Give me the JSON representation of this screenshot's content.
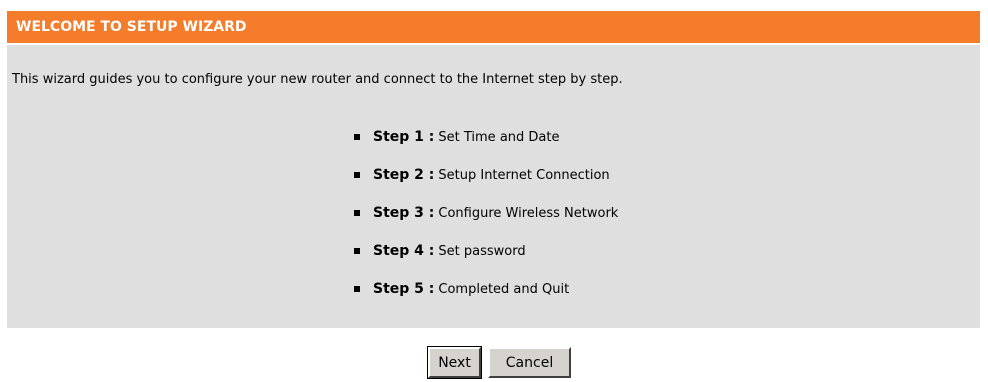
{
  "wizard": {
    "title": "WELCOME TO SETUP WIZARD",
    "intro": "This wizard guides you to configure your new router and connect to the Internet step by step.",
    "steps": [
      {
        "label": "Step 1 :",
        "text": "Set Time and Date"
      },
      {
        "label": "Step 2 :",
        "text": "Setup Internet Connection"
      },
      {
        "label": "Step 3 :",
        "text": "Configure Wireless Network"
      },
      {
        "label": "Step 4 :",
        "text": "Set password"
      },
      {
        "label": "Step 5 :",
        "text": "Completed and Quit"
      }
    ]
  },
  "buttons": {
    "next_label": "Next",
    "cancel_label": "Cancel"
  },
  "colors": {
    "header_bg": "#f47c2a",
    "panel_bg": "#dfdfdf"
  }
}
